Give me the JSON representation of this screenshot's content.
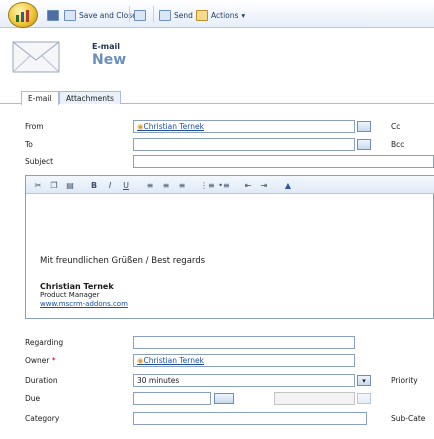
{
  "toolbar": {
    "save_and_close_label": "Save and Close",
    "send_label": "Send",
    "actions_label": "Actions"
  },
  "header": {
    "record_type": "E-mail",
    "title": "New"
  },
  "tabs": [
    "E-mail",
    "Attachments"
  ],
  "form": {
    "from_label": "From",
    "from_value": "Christian Ternek",
    "to_label": "To",
    "subject_label": "Subject",
    "cc_label": "Cc",
    "bcc_label": "Bcc",
    "regarding_label": "Regarding",
    "owner_label": "Owner",
    "owner_value": "Christian Ternek",
    "duration_label": "Duration",
    "duration_value": "30 minutes",
    "priority_label": "Priority",
    "due_label": "Due",
    "category_label": "Category",
    "subcategory_label": "Sub-Cate"
  },
  "editor": {
    "greeting": "Mit freundlichen Grüßen / Best regards",
    "signature_name": "Christian Ternek",
    "signature_role": "Product Manager",
    "signature_link": "www.mscrm-addons.com"
  },
  "colors": {
    "toolbar_bg": "#e6eef9",
    "link": "#1b4fa0",
    "title_blue": "#6a8fb8",
    "border": "#8aa0bd",
    "required": "#cc0000"
  }
}
